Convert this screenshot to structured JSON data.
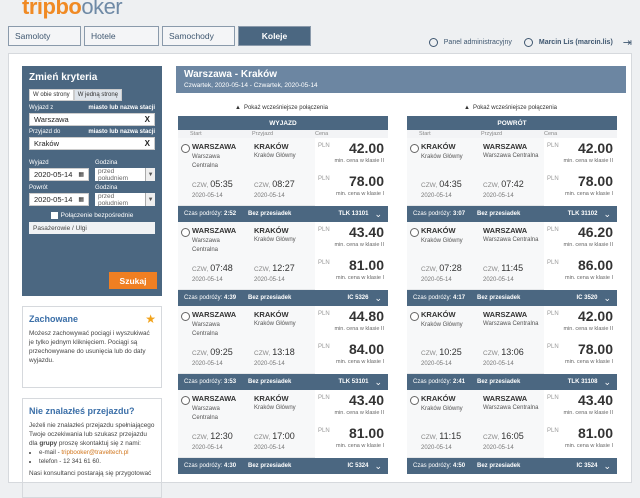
{
  "logo": {
    "part1": "tripbo",
    "part2": "oker"
  },
  "tabs": [
    "Samoloty",
    "Hotele",
    "Samochody",
    "Koleje"
  ],
  "topbar": {
    "admin": "Panel administracyjny",
    "user": "Marcin Lis (marcin.lis)"
  },
  "search": {
    "title": "Zmień kryteria",
    "radio_both": "W obie strony",
    "radio_one": "W jedną stronę",
    "from_label": "Wyjazd z",
    "station_hint": "miasto lub nazwa stacji",
    "from_value": "Warszawa",
    "to_label": "Przyjazd do",
    "to_value": "Kraków",
    "clear": "X",
    "dep_label": "Wyjazd",
    "dep_date": "2020-05-14",
    "time_label": "Godzina",
    "time_value": "przed południem",
    "ret_label": "Powrót",
    "ret_date": "2020-05-14",
    "direct": "Połączenie bezpośrednie",
    "passengers": "Pasażerowie / Ulgi",
    "submit": "Szukaj"
  },
  "saved": {
    "title": "Zachowane",
    "text": "Możesz zachowywać pociągi i wyszukiwać je tylko jednym kliknięciem. Pociągi są przechowywane do usunięcia lub do daty wyjazdu."
  },
  "notfound": {
    "title": "Nie znalazłeś przejazdu?",
    "text1": "Jeżeli nie znalazłeś przejazdu spełniającego Twoje oczekiwania lub szukasz przejazdu dla",
    "bold": "grupy",
    "text2": "proszę skontaktuj się z nami:",
    "email_prefix": "e-mail - ",
    "email": "tripbooker@traveltech.pl",
    "phone": "telefon - 12 341 61 60.",
    "tail": "Nasi konsultanci postarają się przygotować"
  },
  "route": {
    "title": "Warszawa - Kraków",
    "dates": "Czwartek, 2020-05-14 - Czwartek, 2020-05-14"
  },
  "common": {
    "earlier": "Pokaż wcześniejsze połączenia",
    "start_col": "Start",
    "arr_col": "Przyjazd",
    "price_col": "Cena",
    "cur": "PLN",
    "note2": "min. cena w klasie II",
    "note1": "min. cena w klasie I",
    "travel": "Czas podróży:",
    "direct": "Bez przesiadek",
    "day": "CZW,"
  },
  "outbound": {
    "header": "WYJAZD",
    "trains": [
      {
        "from": "WARSZAWA",
        "from_sub": "Warszawa Centralna",
        "to": "KRAKÓW",
        "to_sub": "Kraków Główny",
        "dep": "05:35",
        "arr": "08:27",
        "date": "2020-05-14",
        "p2": "42.00",
        "p1": "78.00",
        "dur": "2:52",
        "num": "TLK 13101"
      },
      {
        "from": "WARSZAWA",
        "from_sub": "Warszawa Centralna",
        "to": "KRAKÓW",
        "to_sub": "Kraków Główny",
        "dep": "07:48",
        "arr": "12:27",
        "date": "2020-05-14",
        "p2": "43.40",
        "p1": "81.00",
        "dur": "4:39",
        "num": "IC 5326"
      },
      {
        "from": "WARSZAWA",
        "from_sub": "Warszawa Centralna",
        "to": "KRAKÓW",
        "to_sub": "Kraków Główny",
        "dep": "09:25",
        "arr": "13:18",
        "date": "2020-05-14",
        "p2": "44.80",
        "p1": "84.00",
        "dur": "3:53",
        "num": "TLK 53101"
      },
      {
        "from": "WARSZAWA",
        "from_sub": "Warszawa Centralna",
        "to": "KRAKÓW",
        "to_sub": "Kraków Główny",
        "dep": "12:30",
        "arr": "17:00",
        "date": "2020-05-14",
        "p2": "43.40",
        "p1": "81.00",
        "dur": "4:30",
        "num": "IC 5324"
      }
    ]
  },
  "inbound": {
    "header": "POWRÓT",
    "trains": [
      {
        "from": "KRAKÓW",
        "from_sub": "Kraków Główny",
        "to": "WARSZAWA",
        "to_sub": "Warszawa Centralna",
        "dep": "04:35",
        "arr": "07:42",
        "date": "2020-05-14",
        "p2": "42.00",
        "p1": "78.00",
        "dur": "3:07",
        "num": "TLK 31102"
      },
      {
        "from": "KRAKÓW",
        "from_sub": "Kraków Główny",
        "to": "WARSZAWA",
        "to_sub": "Warszawa Centralna",
        "dep": "07:28",
        "arr": "11:45",
        "date": "2020-05-14",
        "p2": "46.20",
        "p1": "86.00",
        "dur": "4:17",
        "num": "IC 3520"
      },
      {
        "from": "KRAKÓW",
        "from_sub": "Kraków Główny",
        "to": "WARSZAWA",
        "to_sub": "Warszawa Centralna",
        "dep": "10:25",
        "arr": "13:06",
        "date": "2020-05-14",
        "p2": "42.00",
        "p1": "78.00",
        "dur": "2:41",
        "num": "TLK 31108"
      },
      {
        "from": "KRAKÓW",
        "from_sub": "Kraków Główny",
        "to": "WARSZAWA",
        "to_sub": "Warszawa Centralna",
        "dep": "11:15",
        "arr": "16:05",
        "date": "2020-05-14",
        "p2": "43.40",
        "p1": "81.00",
        "dur": "4:50",
        "num": "IC 3524"
      }
    ]
  }
}
